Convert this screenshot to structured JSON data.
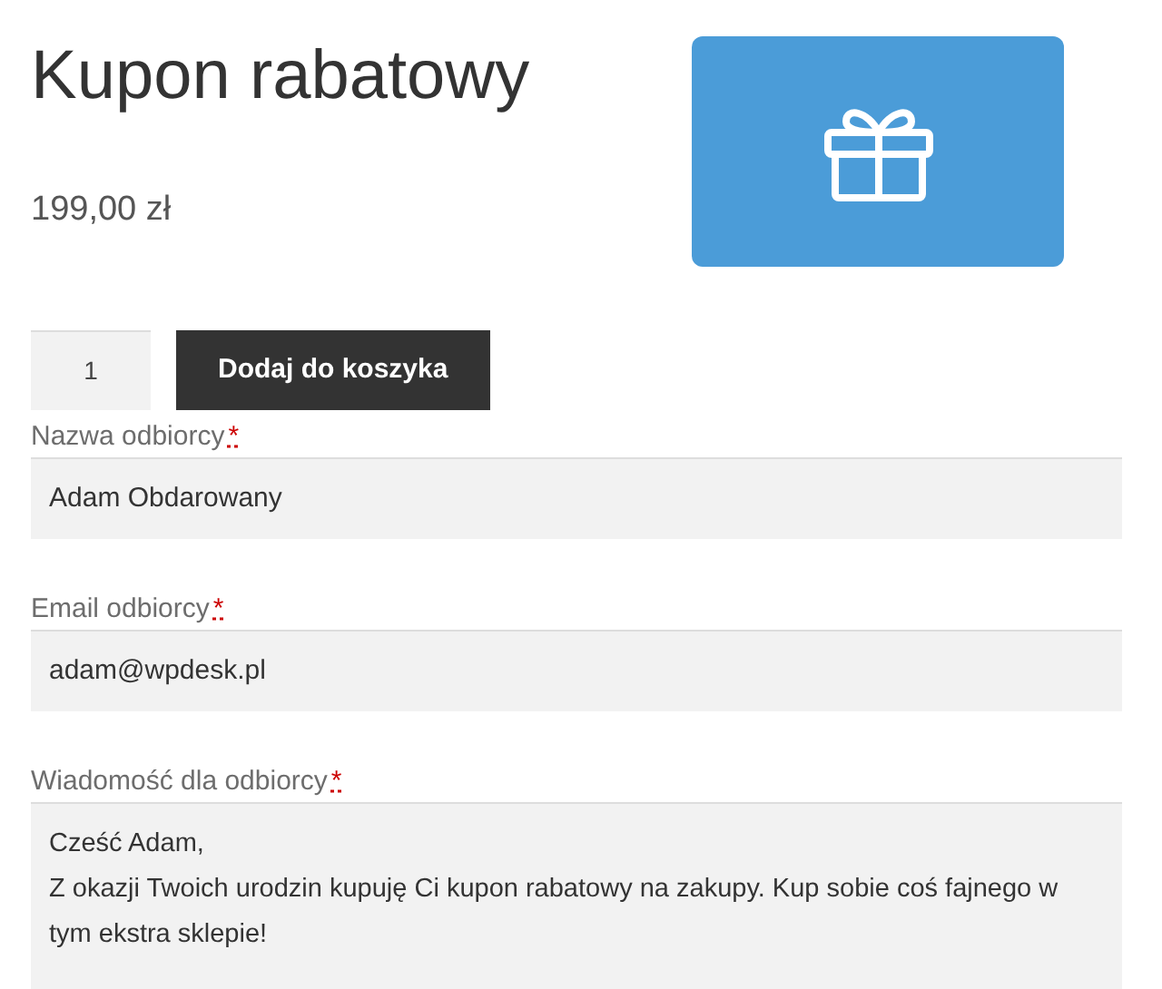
{
  "product": {
    "title": "Kupon rabatowy",
    "price": "199,00 zł"
  },
  "cart": {
    "quantity": "1",
    "button": "Dodaj do koszyka"
  },
  "fields": [
    {
      "label": "Nazwa odbiorcy",
      "required_mark": "*",
      "kind": "input",
      "value": "Adam Obdarowany"
    },
    {
      "label": "Email odbiorcy",
      "required_mark": "*",
      "kind": "input",
      "value": "adam@wpdesk.pl"
    },
    {
      "label": "Wiadomość dla odbiorcy",
      "required_mark": "*",
      "kind": "textarea",
      "value": "Cześć Adam,\nZ okazji Twoich urodzin kupuję Ci kupon rabatowy na zakupy. Kup sobie coś fajnego w tym ekstra sklepie!"
    }
  ]
}
